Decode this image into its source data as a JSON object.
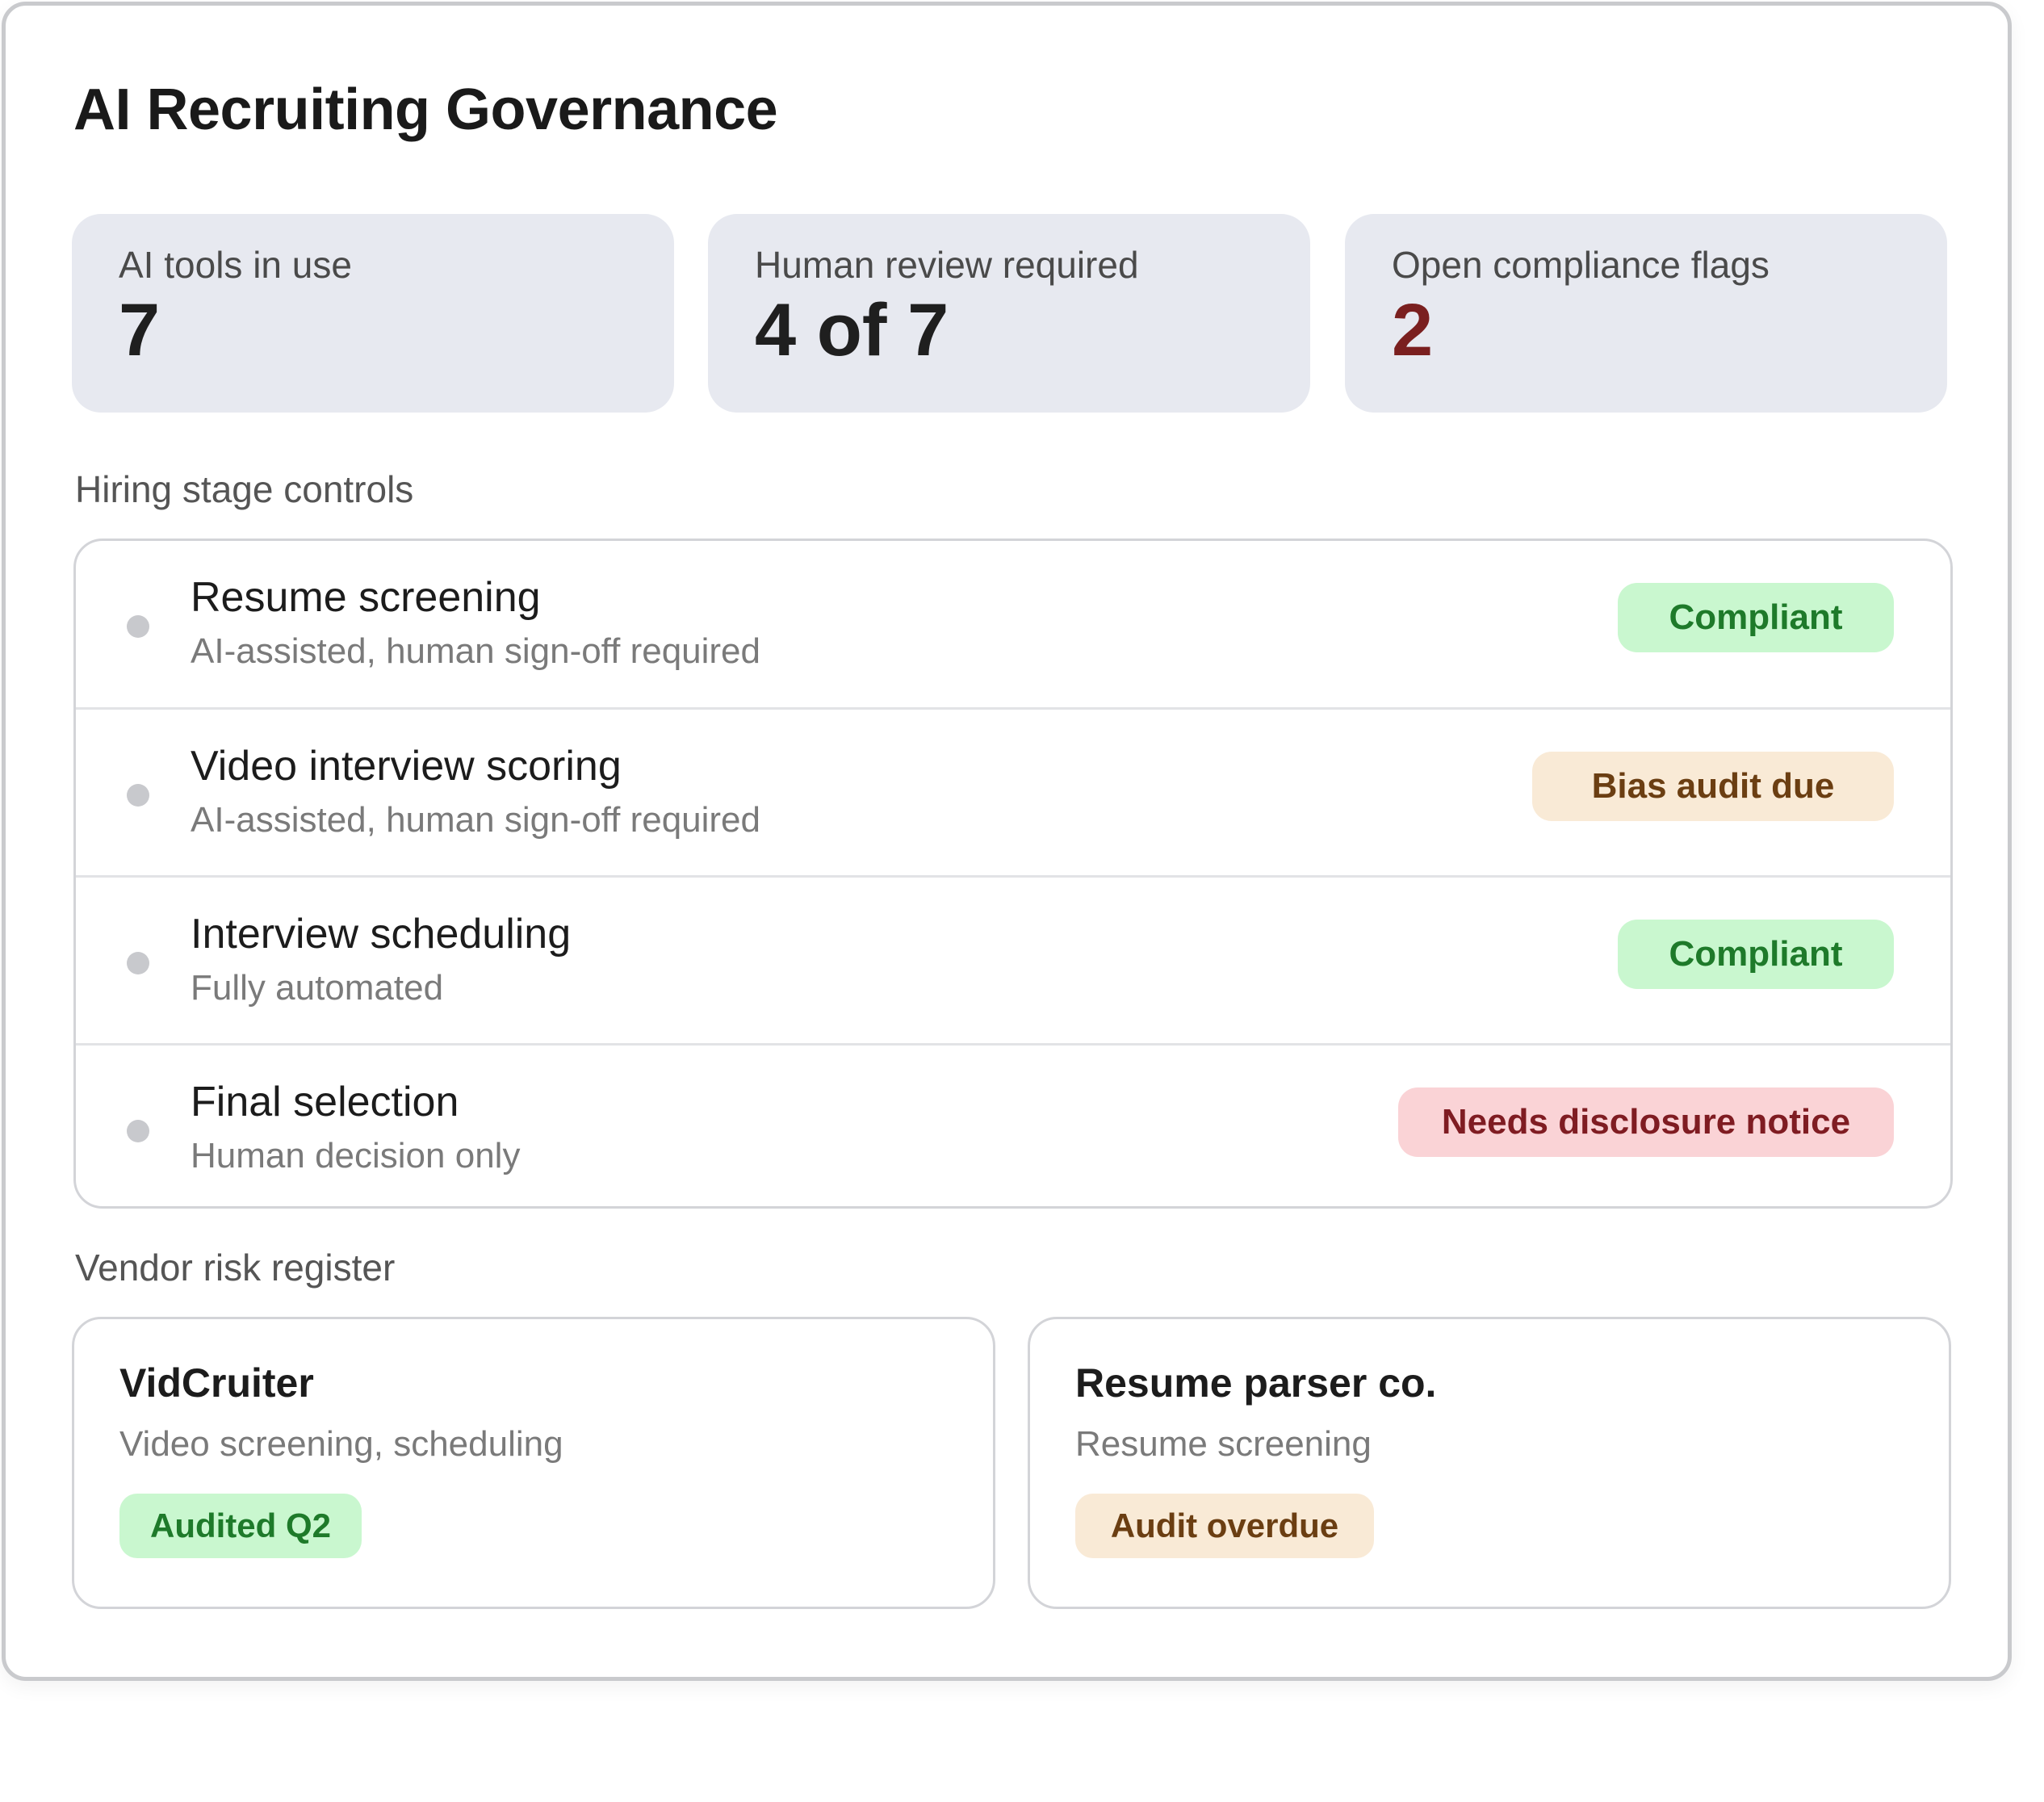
{
  "title": "AI Recruiting Governance",
  "stats": [
    {
      "label": "AI tools in use",
      "value": "7"
    },
    {
      "label": "Human review required",
      "value": "4 of 7"
    },
    {
      "label": "Open compliance flags",
      "value": "2"
    }
  ],
  "sections": {
    "stages": "Hiring stage controls",
    "vendors": "Vendor risk register"
  },
  "stages": [
    {
      "name": "Resume screening",
      "detail": "AI-assisted, human sign-off required",
      "status": "Compliant"
    },
    {
      "name": "Video interview scoring",
      "detail": "AI-assisted, human sign-off required",
      "status": "Bias audit due"
    },
    {
      "name": "Interview scheduling",
      "detail": "Fully automated",
      "status": "Compliant"
    },
    {
      "name": "Final selection",
      "detail": "Human decision only",
      "status": "Needs disclosure notice"
    }
  ],
  "vendors": [
    {
      "name": "VidCruiter",
      "use": "Video screening, scheduling",
      "status": "Audited Q2"
    },
    {
      "name": "Resume parser co.",
      "use": "Resume screening",
      "status": "Audit overdue"
    }
  ],
  "colors": {
    "compliant_bg": "#c9f7cf",
    "compliant_text": "#1e7a2a",
    "warning_bg": "#f9ead6",
    "warning_text": "#6b3e12",
    "alert_bg": "#fad3d6",
    "alert_text": "#7f1c22",
    "flag_count": "#7a1f1f"
  }
}
